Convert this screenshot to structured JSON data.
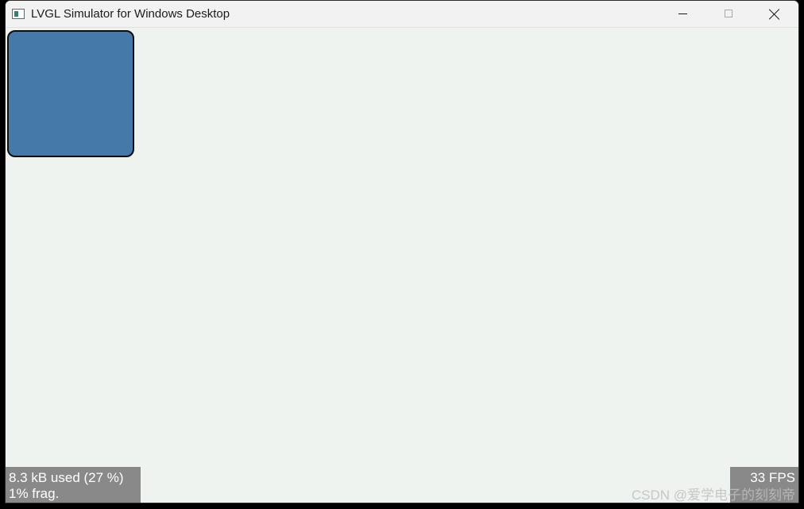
{
  "window": {
    "title": "LVGL Simulator for Windows Desktop"
  },
  "titlebar": {
    "icons": {
      "app": "app-window-icon",
      "minimize": "minimize-icon",
      "maximize": "maximize-icon",
      "close": "close-icon"
    }
  },
  "canvas": {
    "background_color": "#eff3f0",
    "object": {
      "color": "#4479a8",
      "border_color": "#0d0d0d"
    }
  },
  "memory_monitor": {
    "line1": "8.3 kB used (27 %)",
    "line2": "1% frag."
  },
  "performance_monitor": {
    "fps_label": "33 FPS"
  },
  "watermark": {
    "text": "CSDN @爱学电子的刻刻帝"
  }
}
